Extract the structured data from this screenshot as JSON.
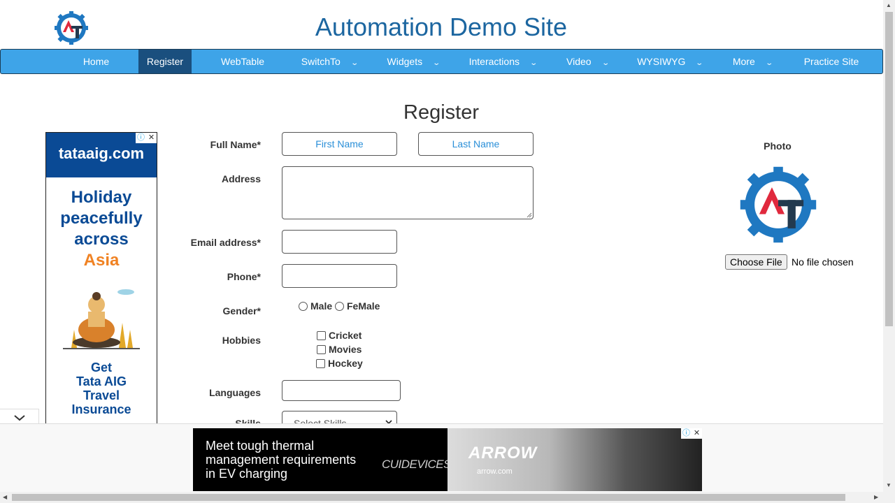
{
  "header": {
    "title": "Automation Demo Site",
    "logo_icon": "at-gear-logo"
  },
  "nav": {
    "items": [
      {
        "label": "Home",
        "dropdown": false,
        "active": false
      },
      {
        "label": "Register",
        "dropdown": false,
        "active": true
      },
      {
        "label": "WebTable",
        "dropdown": false,
        "active": false
      },
      {
        "label": "SwitchTo",
        "dropdown": true,
        "active": false
      },
      {
        "label": "Widgets",
        "dropdown": true,
        "active": false
      },
      {
        "label": "Interactions",
        "dropdown": true,
        "active": false
      },
      {
        "label": "Video",
        "dropdown": true,
        "active": false
      },
      {
        "label": "WYSIWYG",
        "dropdown": true,
        "active": false
      },
      {
        "label": "More",
        "dropdown": true,
        "active": false
      },
      {
        "label": "Practice Site",
        "dropdown": false,
        "active": false
      }
    ]
  },
  "page": {
    "heading": "Register"
  },
  "form": {
    "full_name_label": "Full Name*",
    "first_name_placeholder": "First Name",
    "last_name_placeholder": "Last Name",
    "address_label": "Address",
    "address_value": "",
    "email_label": "Email address*",
    "email_value": "",
    "phone_label": "Phone*",
    "phone_value": "",
    "gender_label": "Gender*",
    "gender_options": [
      "Male",
      "FeMale"
    ],
    "hobbies_label": "Hobbies",
    "hobbies": [
      "Cricket",
      "Movies",
      "Hockey"
    ],
    "languages_label": "Languages",
    "languages_value": "",
    "skills_label": "Skills",
    "skills_selected": "Select Skills"
  },
  "photo": {
    "label": "Photo",
    "choose_button": "Choose File",
    "status": "No file chosen"
  },
  "ad_left": {
    "brand": "tataaig.com",
    "line1": "Holiday",
    "line2": "peacefully",
    "line3": "across",
    "line4": "Asia",
    "cta1": "Get",
    "cta2": "Tata AIG",
    "cta3": "Travel",
    "cta4": "Insurance"
  },
  "ad_bottom": {
    "line1": "Meet tough thermal",
    "line2": "management requirements",
    "line3": "in EV charging",
    "brand1": "CUIDEVICES",
    "brand2": "ARROW",
    "brand2_url": "arrow.com"
  },
  "colors": {
    "nav_bg": "#3ea4e8",
    "nav_active": "#1a4f7e",
    "title": "#1c66a0",
    "ad_blue": "#0a4a95",
    "ad_orange": "#f08223"
  }
}
